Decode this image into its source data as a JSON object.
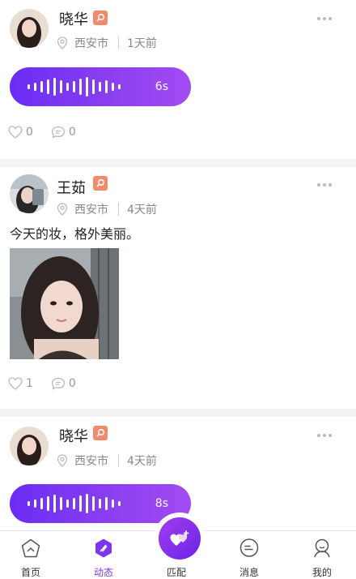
{
  "posts": [
    {
      "name": "晓华",
      "location": "西安市",
      "time": "1天前",
      "voice_duration": "6s",
      "likes": "0",
      "comments": "0"
    },
    {
      "name": "王茹",
      "location": "西安市",
      "time": "4天前",
      "text": "今天的妆，格外美丽。",
      "likes": "1",
      "comments": "0"
    },
    {
      "name": "晓华",
      "location": "西安市",
      "time": "4天前",
      "voice_duration": "8s"
    }
  ],
  "tabs": [
    {
      "label": "首页",
      "icon": "home-icon"
    },
    {
      "label": "动态",
      "icon": "feed-icon",
      "active": true
    },
    {
      "label": "匹配",
      "icon": "match-heart-icon"
    },
    {
      "label": "消息",
      "icon": "message-icon"
    },
    {
      "label": "我的",
      "icon": "profile-icon"
    }
  ],
  "colors": {
    "accent": "#7d36ee",
    "badge": "#f38a6d",
    "voice_start": "#6a2cf5",
    "voice_end": "#a24bf2"
  }
}
